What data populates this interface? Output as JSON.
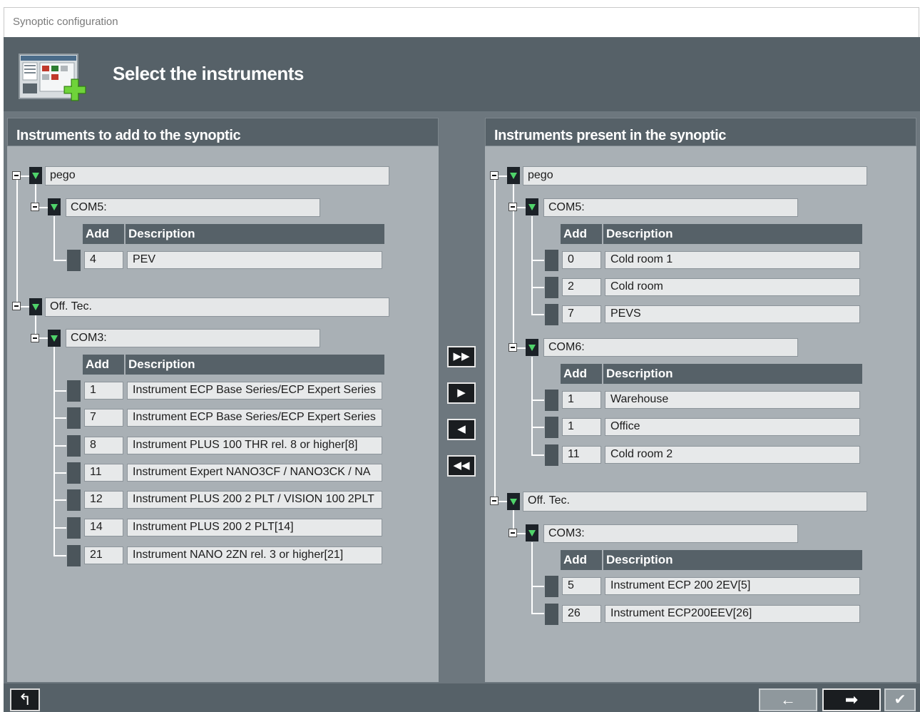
{
  "window": {
    "title": "Synoptic configuration"
  },
  "header": {
    "title": "Select the instruments",
    "icon": "synoptic-add-icon"
  },
  "left_panel": {
    "title": "Instruments to add to the synoptic",
    "groups": [
      {
        "name": "pego",
        "ports": [
          {
            "name": "COM5:",
            "rows": [
              {
                "add": "4",
                "desc": "PEV"
              }
            ]
          }
        ]
      },
      {
        "name": "Off. Tec.",
        "ports": [
          {
            "name": "COM3:",
            "rows": [
              {
                "add": "1",
                "desc": "Instrument ECP Base Series/ECP Expert Series"
              },
              {
                "add": "7",
                "desc": "Instrument ECP Base Series/ECP Expert Series"
              },
              {
                "add": "8",
                "desc": "Instrument PLUS 100 THR rel. 8 or higher[8]"
              },
              {
                "add": "11",
                "desc": "Instrument Expert NANO3CF / NANO3CK / NA"
              },
              {
                "add": "12",
                "desc": "Instrument PLUS 200 2 PLT / VISION 100 2PLT"
              },
              {
                "add": "14",
                "desc": "Instrument PLUS 200 2 PLT[14]"
              },
              {
                "add": "21",
                "desc": "Instrument NANO 2ZN rel. 3 or higher[21]"
              }
            ]
          }
        ]
      }
    ]
  },
  "right_panel": {
    "title": "Instruments present in the synoptic",
    "groups": [
      {
        "name": "pego",
        "ports": [
          {
            "name": "COM5:",
            "rows": [
              {
                "add": "0",
                "desc": "Cold room 1"
              },
              {
                "add": "2",
                "desc": "Cold room"
              },
              {
                "add": "7",
                "desc": "PEVS"
              }
            ]
          },
          {
            "name": "COM6:",
            "rows": [
              {
                "add": "1",
                "desc": "Warehouse"
              },
              {
                "add": "1",
                "desc": "Office"
              },
              {
                "add": "11",
                "desc": "Cold room 2"
              }
            ]
          }
        ]
      },
      {
        "name": "Off. Tec.",
        "ports": [
          {
            "name": "COM3:",
            "rows": [
              {
                "add": "5",
                "desc": "Instrument ECP 200 2EV[5]"
              },
              {
                "add": "26",
                "desc": "Instrument ECP200EEV[26]"
              }
            ]
          }
        ]
      }
    ]
  },
  "table_headers": {
    "add": "Add",
    "description": "Description"
  },
  "move_buttons": {
    "add_all": "▶▶",
    "add_one": "▶",
    "remove_one": "◀",
    "remove_all": "◀◀"
  },
  "footer": {
    "back_label": "↰",
    "prev_label": "←",
    "next_label": "➡",
    "finish_label": "✔"
  }
}
